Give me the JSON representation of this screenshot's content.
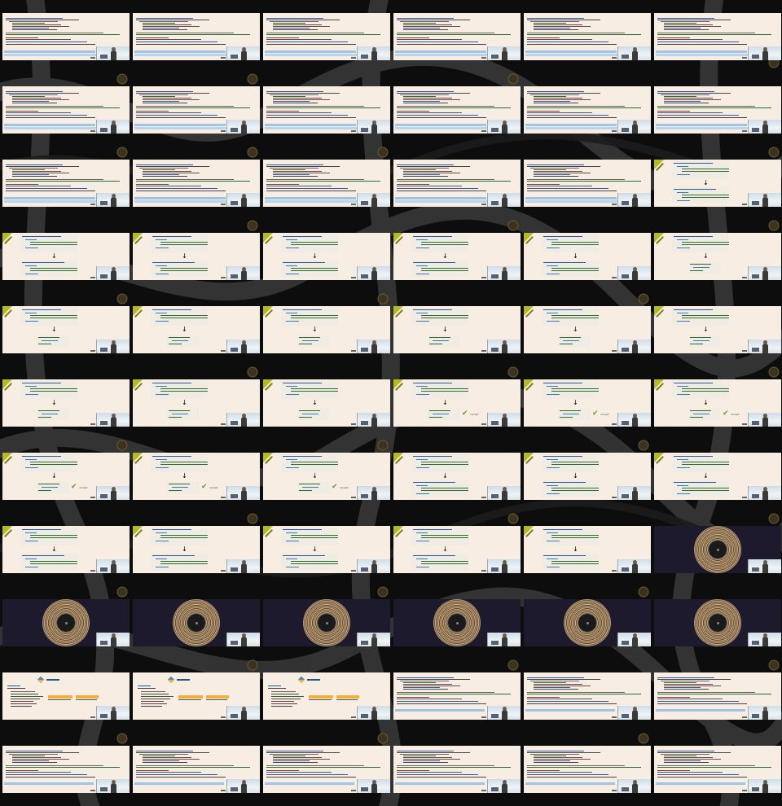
{
  "frame_grid": {
    "columns": 6,
    "rows": 11
  },
  "colors": {
    "slide_bg": "#f8ede2",
    "accent_corner": "#b4bb22",
    "vinyl_bg": "#1c1a2c",
    "highlight": "#9ec4ea",
    "background": "#0d0d0d"
  },
  "frames": [
    "code",
    "code",
    "code",
    "code",
    "code",
    "code",
    "code",
    "code",
    "code",
    "code",
    "code",
    "code",
    "code",
    "code",
    "code",
    "code",
    "code",
    "xml",
    "xml",
    "xml",
    "xml",
    "xml",
    "xml",
    "xml-single",
    "xml-single",
    "xml-single",
    "xml-single",
    "xml-single",
    "xml-single",
    "xml-single",
    "xml-single",
    "xml-single",
    "xml-single",
    "xml-check",
    "xml-check",
    "xml-check",
    "xml-check",
    "xml-check",
    "xml-check",
    "xml",
    "xml",
    "xml",
    "xml",
    "xml",
    "xml",
    "xml",
    "xml",
    "vinyl",
    "vinyl",
    "vinyl",
    "vinyl",
    "vinyl",
    "vinyl",
    "vinyl",
    "keyword",
    "keyword",
    "keyword",
    "code2",
    "code2",
    "code2",
    "code2",
    "code2",
    "code2",
    "code2",
    "code2",
    "code2"
  ],
  "overlay_text": {
    "check_label": "correct",
    "arrow_glyph": "↓",
    "check_glyph": "✔"
  },
  "icons": {
    "corner": "corner-ribbon-icon",
    "camera": "webcam-overlay",
    "disc": "vinyl-disc-icon",
    "keyword": "keyword-diamond-icon"
  }
}
